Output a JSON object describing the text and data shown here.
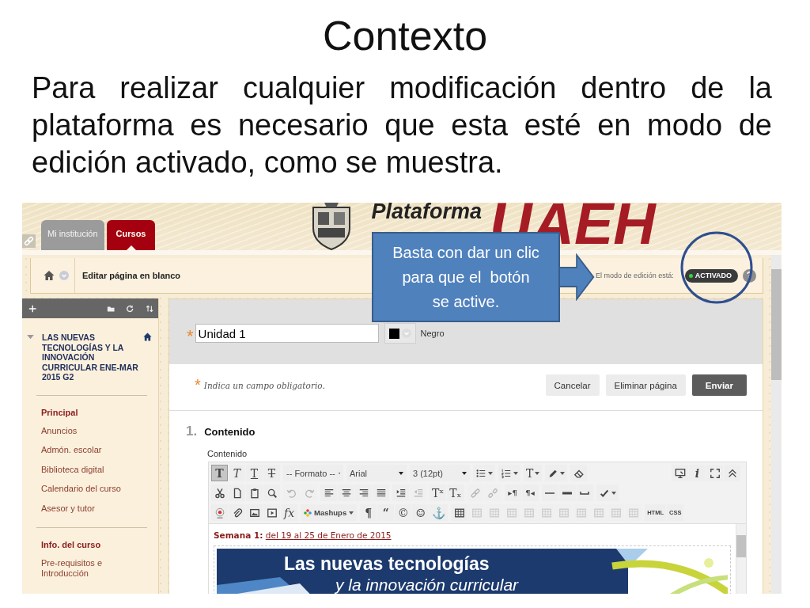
{
  "slide": {
    "title": "Contexto",
    "body": "Para realizar cualquier modificación dentro de la plataforma es necesario que esta esté en modo de edición activado, como se muestra."
  },
  "header": {
    "logo_lines": [
      "Plataforma"
    ],
    "logo_mark": "UAEH",
    "tabs": [
      {
        "label": "Mi institución",
        "selected": false
      },
      {
        "label": "Cursos",
        "selected": true
      }
    ]
  },
  "breadcrumb": {
    "page": "Editar página en blanco",
    "edit_mode_label": "El modo de edición está:",
    "edit_mode": {
      "label": "ACTIVADO",
      "on": true
    },
    "help": "?"
  },
  "sidebar": {
    "course_title": "LAS NUEVAS TECNOLOGÍAS Y LA INNOVACIÓN CURRICULAR ENE-MAR 2015 G2",
    "sections": [
      {
        "heading": "Principal",
        "items": [
          "Anuncios",
          "Admón. escolar",
          "Biblioteca digital",
          "Calendario del curso",
          "Asesor y tutor"
        ]
      },
      {
        "heading": "Info. del curso",
        "items": [
          "Pre-requisitos e Introducción"
        ]
      }
    ]
  },
  "form": {
    "title_field": {
      "required_mark": "*",
      "value": "Unidad 1"
    },
    "color_name": "Negro",
    "required_note": {
      "mark": "*",
      "text": "Indica un campo obligatorio."
    },
    "buttons": [
      {
        "label": "Cancelar",
        "kind": "secondary"
      },
      {
        "label": "Eliminar página",
        "kind": "secondary"
      },
      {
        "label": "Enviar",
        "kind": "primary"
      }
    ],
    "step_number": "1.",
    "step_title": "Contenido",
    "field_label": "Contenido"
  },
  "editor": {
    "toolbar_rows": [
      {
        "groups": [
          [
            {
              "kind": "glyph",
              "glyph": "T",
              "on": true,
              "disabled": false
            },
            {
              "kind": "glyph",
              "glyph": "T",
              "on": false,
              "disabled": false
            },
            {
              "kind": "glyph",
              "glyph": "T",
              "on": false,
              "disabled": false
            },
            {
              "kind": "glyph",
              "glyph": "T",
              "on": false,
              "disabled": false
            }
          ],
          [
            {
              "kind": "select",
              "label": "-- Formato --",
              "on": false,
              "disabled": false
            }
          ],
          [
            {
              "kind": "select",
              "label": "Arial",
              "on": false,
              "disabled": false
            }
          ],
          [
            {
              "kind": "select",
              "label": "3 (12pt)",
              "on": false,
              "disabled": false
            }
          ],
          [
            {
              "kind": "icon",
              "menu": true,
              "on": false,
              "disabled": false
            }
          ],
          [
            {
              "kind": "icon",
              "menu": true,
              "on": false,
              "disabled": false
            }
          ],
          [
            {
              "kind": "glyph",
              "glyph": "T",
              "menu": true,
              "on": false,
              "disabled": false
            }
          ],
          [
            {
              "kind": "icon",
              "menu": true,
              "on": false,
              "disabled": false
            }
          ],
          [
            {
              "kind": "icon",
              "on": false,
              "disabled": false
            }
          ]
        ],
        "end_groups": [
          [
            {
              "kind": "icon",
              "on": false,
              "disabled": false
            },
            {
              "kind": "glyph",
              "glyph": "i",
              "on": false,
              "disabled": false
            },
            {
              "kind": "icon",
              "on": false,
              "disabled": false
            },
            {
              "kind": "icon",
              "on": false,
              "disabled": false
            }
          ]
        ]
      },
      {
        "groups": [
          [
            {
              "kind": "icon",
              "on": false,
              "disabled": false
            },
            {
              "kind": "icon",
              "on": false,
              "disabled": false
            },
            {
              "kind": "icon",
              "on": false,
              "disabled": false
            },
            {
              "kind": "icon",
              "on": false,
              "disabled": false
            }
          ],
          [
            {
              "kind": "icon",
              "on": false,
              "disabled": true
            },
            {
              "kind": "icon",
              "on": false,
              "disabled": true
            }
          ],
          [
            {
              "kind": "icon",
              "on": false,
              "disabled": false
            },
            {
              "kind": "icon",
              "on": false,
              "disabled": false
            },
            {
              "kind": "icon",
              "on": false,
              "disabled": false
            },
            {
              "kind": "icon",
              "on": false,
              "disabled": false
            }
          ],
          [
            {
              "kind": "icon",
              "on": false,
              "disabled": false
            },
            {
              "kind": "icon",
              "on": false,
              "disabled": true
            }
          ],
          [
            {
              "kind": "glyph",
              "glyph": "Tˣ",
              "on": false,
              "disabled": false
            },
            {
              "kind": "glyph",
              "glyph": "Tₓ",
              "on": false,
              "disabled": false
            }
          ],
          [
            {
              "kind": "icon",
              "on": false,
              "disabled": true
            },
            {
              "kind": "icon",
              "on": false,
              "disabled": true
            }
          ],
          [
            {
              "kind": "glyph",
              "glyph": "▸¶",
              "on": false,
              "disabled": false
            },
            {
              "kind": "glyph",
              "glyph": "¶◂",
              "on": false,
              "disabled": false
            }
          ],
          [
            {
              "kind": "icon",
              "on": false,
              "disabled": false
            },
            {
              "kind": "icon",
              "on": false,
              "disabled": false
            },
            {
              "kind": "icon",
              "on": false,
              "disabled": false
            }
          ],
          [
            {
              "kind": "icon",
              "menu": true,
              "on": false,
              "disabled": false
            }
          ]
        ]
      },
      {
        "groups": [
          [
            {
              "kind": "icon",
              "on": false,
              "disabled": false
            },
            {
              "kind": "icon",
              "on": false,
              "disabled": false
            },
            {
              "kind": "icon",
              "on": false,
              "disabled": false
            },
            {
              "kind": "icon",
              "on": false,
              "disabled": false
            },
            {
              "kind": "glyph",
              "glyph": "fx",
              "on": false,
              "disabled": false
            }
          ],
          [
            {
              "kind": "plugin",
              "label": "Mashups",
              "menu": true,
              "on": false,
              "disabled": false
            }
          ],
          [
            {
              "kind": "glyph",
              "glyph": "¶",
              "on": false,
              "disabled": false
            },
            {
              "kind": "glyph",
              "glyph": "“",
              "on": false,
              "disabled": false
            },
            {
              "kind": "glyph",
              "glyph": "©",
              "on": false,
              "disabled": false
            },
            {
              "kind": "glyph",
              "glyph": "☺",
              "on": false,
              "disabled": false
            },
            {
              "kind": "glyph",
              "glyph": "⚓",
              "on": false,
              "disabled": false
            }
          ],
          [
            {
              "kind": "icon",
              "on": false,
              "disabled": false
            },
            {
              "kind": "icon",
              "on": false,
              "disabled": true
            },
            {
              "kind": "icon",
              "on": false,
              "disabled": true
            },
            {
              "kind": "icon",
              "on": false,
              "disabled": true
            },
            {
              "kind": "icon",
              "on": false,
              "disabled": true
            },
            {
              "kind": "icon",
              "on": false,
              "disabled": true
            },
            {
              "kind": "icon",
              "on": false,
              "disabled": true
            },
            {
              "kind": "icon",
              "on": false,
              "disabled": true
            },
            {
              "kind": "icon",
              "on": false,
              "disabled": true
            },
            {
              "kind": "icon",
              "on": false,
              "disabled": true
            },
            {
              "kind": "icon",
              "on": false,
              "disabled": true
            }
          ],
          [
            {
              "kind": "glyph",
              "glyph": "HTML",
              "on": false,
              "disabled": false
            },
            {
              "kind": "glyph",
              "glyph": "CSS",
              "on": false,
              "disabled": false
            }
          ]
        ]
      }
    ],
    "content": {
      "label": "Semana 1:",
      "link": "del 19 al 25 de Enero de 2015",
      "banner_lines": [
        "Las nuevas tecnologías",
        "y la innovación curricular"
      ]
    }
  },
  "callout": {
    "text": "Basta con dar un clic\npara que el  botón\nse active."
  }
}
